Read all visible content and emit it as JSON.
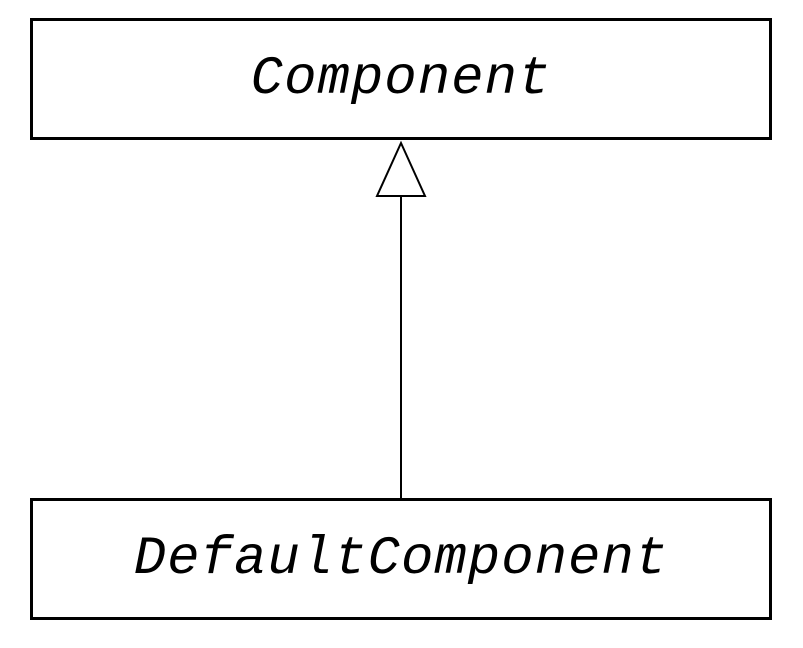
{
  "diagram": {
    "type": "uml-class-inheritance",
    "parent": {
      "name": "Component",
      "stereotype": "interface-or-abstract"
    },
    "child": {
      "name": "DefaultComponent",
      "stereotype": "interface-or-abstract"
    },
    "relationship": "generalization"
  }
}
